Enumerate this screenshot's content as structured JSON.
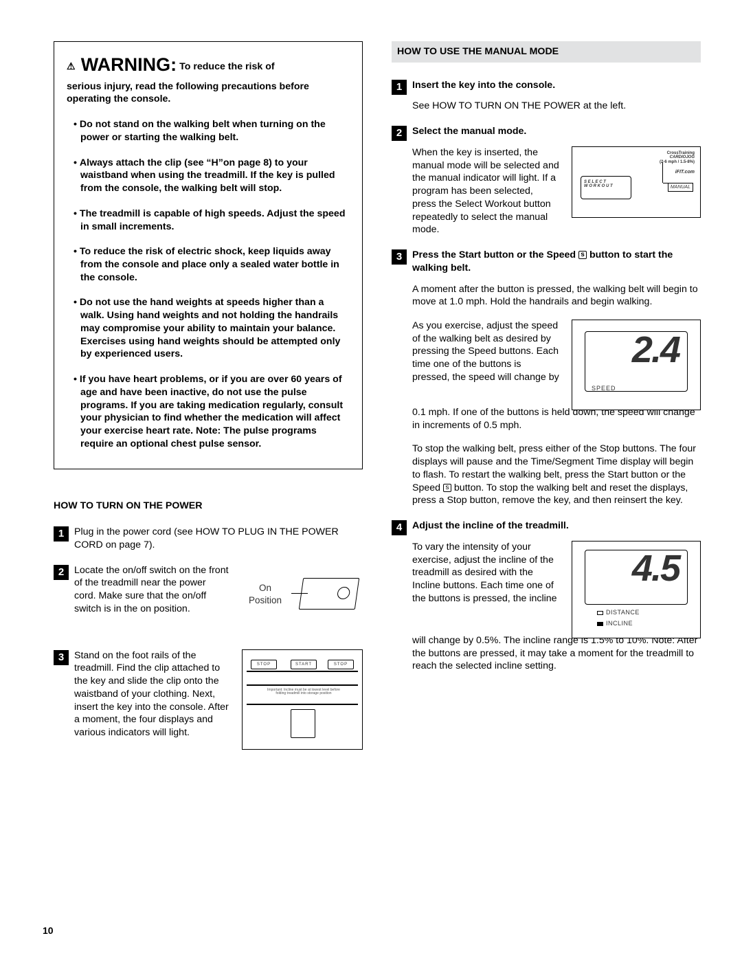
{
  "pageNumber": "10",
  "warning": {
    "icon": "⚠",
    "big": "WARNING:",
    "leadSmall": "To reduce the risk of",
    "intro": "serious injury, read the following precautions before operating the console.",
    "bullets": [
      "Do not stand on the walking belt when turning on the power or starting the walking belt.",
      "Always attach the clip (see “H”on page 8) to your waistband when using the treadmill. If the key is pulled from the console, the walking belt will stop.",
      "The treadmill is capable of high speeds. Adjust the speed in small increments.",
      "To reduce the risk of electric shock, keep liquids away from the console and place only a sealed water bottle in the console.",
      "Do not use the hand weights at speeds higher than a walk. Using hand weights and not holding the handrails may compromise your ability to maintain your balance. Exercises using hand weights should be attempted only by experienced users.",
      "If you have heart problems, or if you are over 60 years of age and have been inactive, do not use the pulse programs. If you are taking medication regularly, consult your physician to find whether the medication will affect your exercise heart rate. Note: The pulse programs require an optional chest pulse sensor."
    ]
  },
  "power": {
    "title": "HOW TO TURN ON THE POWER",
    "steps": {
      "s1": {
        "num": "1",
        "text": "Plug in the power cord (see HOW TO PLUG IN THE POWER CORD on page 7)."
      },
      "s2": {
        "num": "2",
        "text": "Locate the on/off switch on the front of the treadmill near the power cord. Make sure that the on/off switch is in the on position."
      },
      "s3": {
        "num": "3",
        "text": "Stand on the foot rails of the treadmill. Find the clip attached to the key and slide the clip onto the waistband of your clothing. Next, insert the key into the console. After a moment, the four displays and various indicators will light."
      }
    },
    "fig_on": {
      "label": "On\nPosition"
    },
    "fig_console": {
      "btn1": "STOP",
      "btn2": "START",
      "btn3": "STOP",
      "tiny": "Important: Incline must be at lowest level before folding treadmill into storage position"
    }
  },
  "manual": {
    "title": "HOW TO USE THE MANUAL MODE",
    "s1": {
      "num": "1",
      "title": "Insert the key into the console.",
      "p1": "See HOW TO TURN ON THE POWER at the left."
    },
    "s2": {
      "num": "2",
      "title": "Select the manual mode.",
      "p1": "When the key is inserted, the manual mode will be selected and the manual indicator will light. If a program has been selected, press the Select Workout button repeatedly to select the manual mode.",
      "fig": {
        "select_line1": "S E L E C T",
        "select_line2": "W O R K O U T",
        "manual": "MANUAL",
        "ct1": "CrossTraining",
        "ct2": "CARDIOJOG",
        "ct3": "(2-6 mph / 1.5-8%)",
        "ifit": "iFIT.com"
      }
    },
    "s3": {
      "num": "3",
      "title_a": "Press the Start button or the Speed ",
      "title_b": " button to start the walking belt.",
      "p1": "A moment after the button is pressed, the walking belt will begin to move at 1.0 mph. Hold the handrails and begin walking.",
      "p2a": "As you exercise, adjust the speed of the walking belt as desired by pressing the Speed buttons. Each time one of the buttons is pressed, the speed will change by",
      "p2b": "0.1 mph. If one of the buttons is held down, the speed will change in increments of 0.5 mph.",
      "p3a": "To stop the walking belt, press either of the Stop buttons. The four displays will pause and the Time/Segment Time display will begin to flash. To restart the walking belt, press the Start button or the Speed ",
      "p3b": " button. To stop the walking belt and reset the displays, press a Stop button, remove the key, and then reinsert the key.",
      "fig": {
        "num": "2.4",
        "label": "SPEED"
      }
    },
    "s4": {
      "num": "4",
      "title": "Adjust the incline of the treadmill.",
      "p1a": "To vary the intensity of your exercise, adjust the incline of the treadmill as desired with the Incline buttons. Each time one of the buttons is pressed, the incline",
      "p1b": "will change by 0.5%. The incline range is 1.5% to 10%. Note: After the buttons are pressed, it may take a moment for the treadmill to reach the selected incline setting.",
      "fig": {
        "num": "4.5",
        "t1": "DISTANCE",
        "t2": "INCLINE"
      }
    }
  }
}
